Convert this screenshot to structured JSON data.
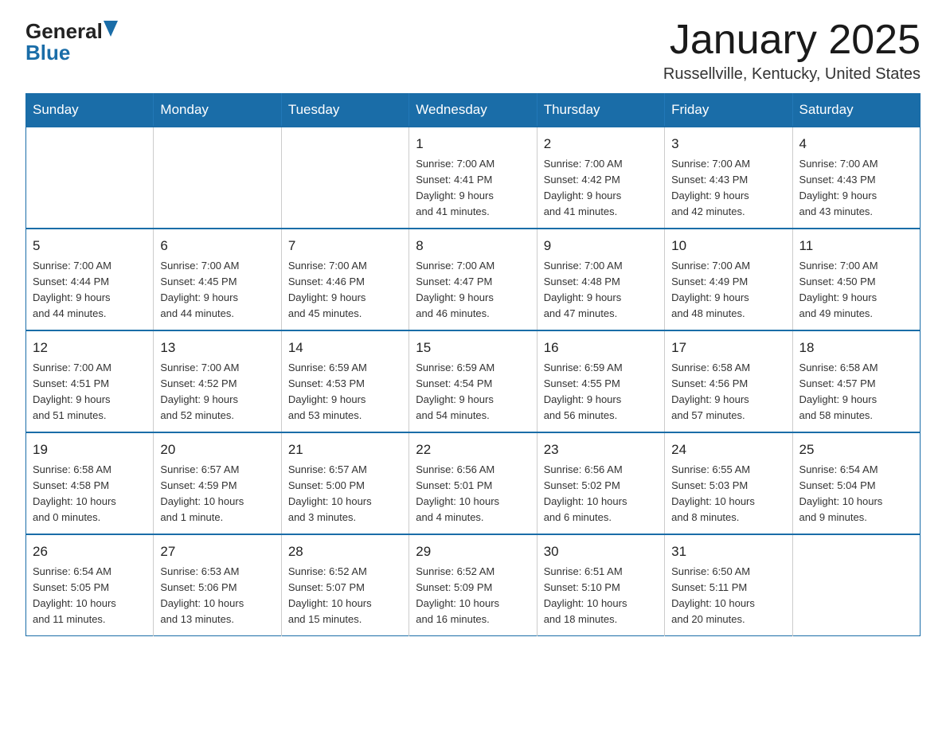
{
  "header": {
    "logo": {
      "text_general": "General",
      "text_blue": "Blue"
    },
    "title": "January 2025",
    "location": "Russellville, Kentucky, United States"
  },
  "weekdays": [
    "Sunday",
    "Monday",
    "Tuesday",
    "Wednesday",
    "Thursday",
    "Friday",
    "Saturday"
  ],
  "weeks": [
    [
      {
        "day": "",
        "info": ""
      },
      {
        "day": "",
        "info": ""
      },
      {
        "day": "",
        "info": ""
      },
      {
        "day": "1",
        "info": "Sunrise: 7:00 AM\nSunset: 4:41 PM\nDaylight: 9 hours\nand 41 minutes."
      },
      {
        "day": "2",
        "info": "Sunrise: 7:00 AM\nSunset: 4:42 PM\nDaylight: 9 hours\nand 41 minutes."
      },
      {
        "day": "3",
        "info": "Sunrise: 7:00 AM\nSunset: 4:43 PM\nDaylight: 9 hours\nand 42 minutes."
      },
      {
        "day": "4",
        "info": "Sunrise: 7:00 AM\nSunset: 4:43 PM\nDaylight: 9 hours\nand 43 minutes."
      }
    ],
    [
      {
        "day": "5",
        "info": "Sunrise: 7:00 AM\nSunset: 4:44 PM\nDaylight: 9 hours\nand 44 minutes."
      },
      {
        "day": "6",
        "info": "Sunrise: 7:00 AM\nSunset: 4:45 PM\nDaylight: 9 hours\nand 44 minutes."
      },
      {
        "day": "7",
        "info": "Sunrise: 7:00 AM\nSunset: 4:46 PM\nDaylight: 9 hours\nand 45 minutes."
      },
      {
        "day": "8",
        "info": "Sunrise: 7:00 AM\nSunset: 4:47 PM\nDaylight: 9 hours\nand 46 minutes."
      },
      {
        "day": "9",
        "info": "Sunrise: 7:00 AM\nSunset: 4:48 PM\nDaylight: 9 hours\nand 47 minutes."
      },
      {
        "day": "10",
        "info": "Sunrise: 7:00 AM\nSunset: 4:49 PM\nDaylight: 9 hours\nand 48 minutes."
      },
      {
        "day": "11",
        "info": "Sunrise: 7:00 AM\nSunset: 4:50 PM\nDaylight: 9 hours\nand 49 minutes."
      }
    ],
    [
      {
        "day": "12",
        "info": "Sunrise: 7:00 AM\nSunset: 4:51 PM\nDaylight: 9 hours\nand 51 minutes."
      },
      {
        "day": "13",
        "info": "Sunrise: 7:00 AM\nSunset: 4:52 PM\nDaylight: 9 hours\nand 52 minutes."
      },
      {
        "day": "14",
        "info": "Sunrise: 6:59 AM\nSunset: 4:53 PM\nDaylight: 9 hours\nand 53 minutes."
      },
      {
        "day": "15",
        "info": "Sunrise: 6:59 AM\nSunset: 4:54 PM\nDaylight: 9 hours\nand 54 minutes."
      },
      {
        "day": "16",
        "info": "Sunrise: 6:59 AM\nSunset: 4:55 PM\nDaylight: 9 hours\nand 56 minutes."
      },
      {
        "day": "17",
        "info": "Sunrise: 6:58 AM\nSunset: 4:56 PM\nDaylight: 9 hours\nand 57 minutes."
      },
      {
        "day": "18",
        "info": "Sunrise: 6:58 AM\nSunset: 4:57 PM\nDaylight: 9 hours\nand 58 minutes."
      }
    ],
    [
      {
        "day": "19",
        "info": "Sunrise: 6:58 AM\nSunset: 4:58 PM\nDaylight: 10 hours\nand 0 minutes."
      },
      {
        "day": "20",
        "info": "Sunrise: 6:57 AM\nSunset: 4:59 PM\nDaylight: 10 hours\nand 1 minute."
      },
      {
        "day": "21",
        "info": "Sunrise: 6:57 AM\nSunset: 5:00 PM\nDaylight: 10 hours\nand 3 minutes."
      },
      {
        "day": "22",
        "info": "Sunrise: 6:56 AM\nSunset: 5:01 PM\nDaylight: 10 hours\nand 4 minutes."
      },
      {
        "day": "23",
        "info": "Sunrise: 6:56 AM\nSunset: 5:02 PM\nDaylight: 10 hours\nand 6 minutes."
      },
      {
        "day": "24",
        "info": "Sunrise: 6:55 AM\nSunset: 5:03 PM\nDaylight: 10 hours\nand 8 minutes."
      },
      {
        "day": "25",
        "info": "Sunrise: 6:54 AM\nSunset: 5:04 PM\nDaylight: 10 hours\nand 9 minutes."
      }
    ],
    [
      {
        "day": "26",
        "info": "Sunrise: 6:54 AM\nSunset: 5:05 PM\nDaylight: 10 hours\nand 11 minutes."
      },
      {
        "day": "27",
        "info": "Sunrise: 6:53 AM\nSunset: 5:06 PM\nDaylight: 10 hours\nand 13 minutes."
      },
      {
        "day": "28",
        "info": "Sunrise: 6:52 AM\nSunset: 5:07 PM\nDaylight: 10 hours\nand 15 minutes."
      },
      {
        "day": "29",
        "info": "Sunrise: 6:52 AM\nSunset: 5:09 PM\nDaylight: 10 hours\nand 16 minutes."
      },
      {
        "day": "30",
        "info": "Sunrise: 6:51 AM\nSunset: 5:10 PM\nDaylight: 10 hours\nand 18 minutes."
      },
      {
        "day": "31",
        "info": "Sunrise: 6:50 AM\nSunset: 5:11 PM\nDaylight: 10 hours\nand 20 minutes."
      },
      {
        "day": "",
        "info": ""
      }
    ]
  ]
}
